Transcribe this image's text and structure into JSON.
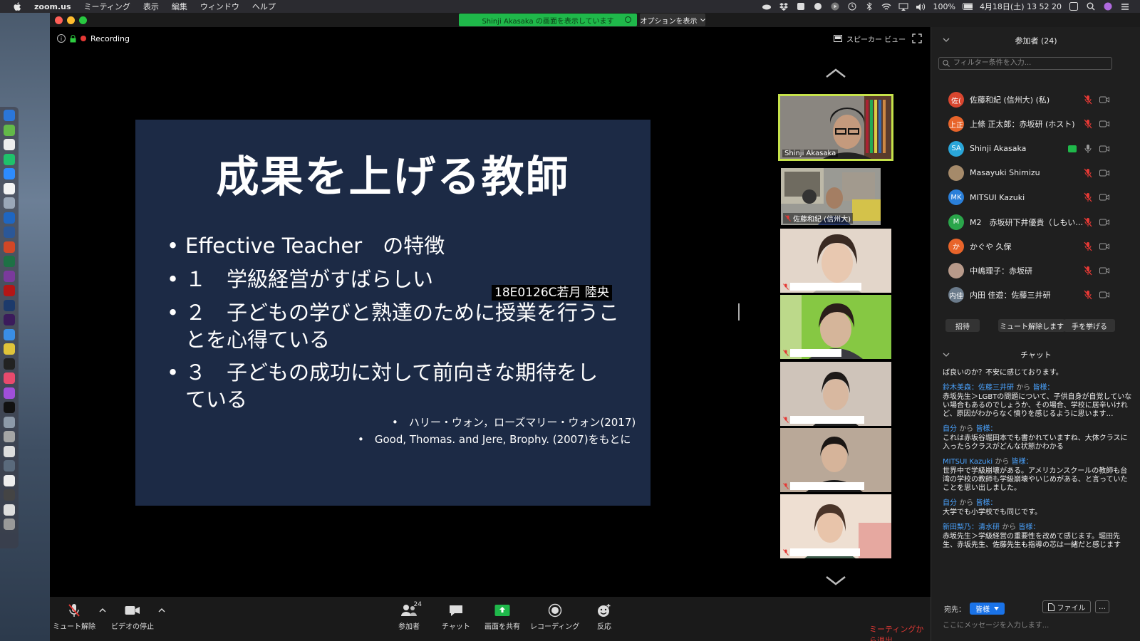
{
  "menubar": {
    "app": "zoom.us",
    "items": [
      "ミーティング",
      "表示",
      "編集",
      "ウィンドウ",
      "ヘルプ"
    ],
    "battery": "100%",
    "datetime": "4月18日(土) 13 52 20"
  },
  "meeting": {
    "share_banner": "Shinji Akasaka の画面を表示しています",
    "options": "オプションを表示",
    "recording": "Recording",
    "speaker_view": "スピーカー ビュー"
  },
  "slide": {
    "title": "成果を上げる教師",
    "bullets": [
      "Effective Teacher　の特徴",
      "１　学級経営がすばらしい",
      "２　子どもの学びと熟達のために授業を行うこ",
      "とを心得ている",
      "３　子どもの成功に対して前向きな期待をし",
      "ている"
    ],
    "bullet_mark": "•",
    "ref1": "•　ハリー・ウォン，ローズマリー・ウォン(2017)",
    "ref2": "•　Good, Thomas. and Jere, Brophy. (2007)をもとに",
    "name_overlay": "18E0126C若月 陸央"
  },
  "thumbnails": [
    {
      "name": "Shinji Akasaka"
    },
    {
      "name": "佐藤和紀 (信州大)"
    }
  ],
  "toolbar": {
    "mute": "ミュート解除",
    "video": "ビデオの停止",
    "participants": "参加者",
    "participants_count": "24",
    "chat": "チャット",
    "share": "画面を共有",
    "record": "レコーディング",
    "reactions": "反応",
    "end": "ミーティングから退出"
  },
  "panel": {
    "participants_title": "参加者 (24)",
    "search_placeholder": "フィルター条件を入力...",
    "participants": [
      {
        "initial": "佐(",
        "name": "佐藤和紀 (信州大) (私)",
        "color": "#d9462f"
      },
      {
        "initial": "上正",
        "name": "上條 正太郎：赤坂研 (ホスト)",
        "color": "#e8642a"
      },
      {
        "initial": "SA",
        "name": "Shinji Akasaka",
        "color": "#2aa6d9"
      },
      {
        "initial": "",
        "name": "Masayuki Shimizu",
        "color": "#a58a6a"
      },
      {
        "initial": "MK",
        "name": "MITSUI Kazuki",
        "color": "#2a7fd9"
      },
      {
        "initial": "M",
        "name": "M2　赤坂研下井優貴（しもいゆ…",
        "color": "#2aa54a"
      },
      {
        "initial": "か",
        "name": "かぐや 久保",
        "color": "#e8642a"
      },
      {
        "initial": "",
        "name": "中嶋理子：赤坂研",
        "color": "#b89a8a"
      },
      {
        "initial": "内佳",
        "name": "内田 佳遊：佐藤三井研",
        "color": "#6a7a8a"
      }
    ],
    "buttons": [
      "招待",
      "ミュート解除します",
      "手を挙げる"
    ],
    "chat_title": "チャット",
    "chat_messages": [
      {
        "from": "",
        "to": "",
        "body": "ば良いのか？不安に感じております。"
      },
      {
        "from": "鈴木美森：佐藤三井研",
        "to": "皆様：",
        "body": "赤坂先生＞LGBTの問題について、子供自身が自覚していない場合もあるのでしょうか、その場合、学校に居辛いけれど、原因がわからなく憤りを感じるように思います…"
      },
      {
        "from": "自分",
        "to": "皆様：",
        "body": "これは赤坂谷堀田本でも書かれていますね、大体クラスに入ったらクラスがどんな状態かわかる"
      },
      {
        "from": "MITSUI Kazuki",
        "to": "皆様：",
        "body": "世界中で学級崩壊がある。アメリカンスクールの教師も台湾の学校の教師も学級崩壊やいじめがある、と言っていたことを思い出しました。"
      },
      {
        "from": "自分",
        "to": "皆様：",
        "body": "大学でも小学校でも同じです。"
      },
      {
        "from": "新田梨乃：清水研",
        "to": "皆様：",
        "body": "赤坂先生＞学級経営の重要性を改めて感じます。堀田先生、赤坂先生、佐藤先生も指導の芯は一緒だと感じます"
      }
    ],
    "kara": "から",
    "to_label": "宛先：",
    "to_value": "皆様",
    "file": "ファイル",
    "more": "…",
    "message_placeholder": "ここにメッセージを入力します..."
  }
}
